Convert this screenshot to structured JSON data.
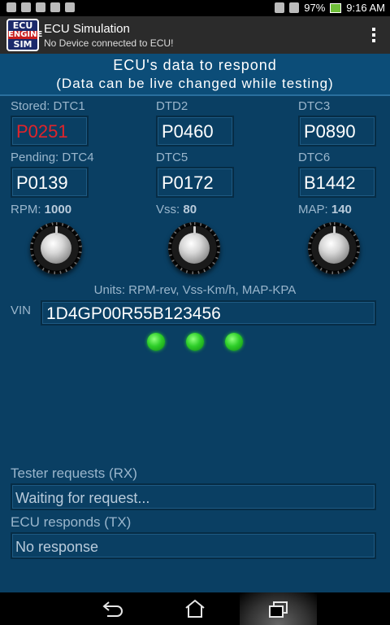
{
  "status_bar": {
    "battery": "97%",
    "time": "9:16 AM"
  },
  "action_bar": {
    "logo": {
      "line1": "ECU",
      "line2": "ENGINE",
      "line3": "SIM"
    },
    "title": "ECU Simulation",
    "subtitle": "No Device connected to ECU!"
  },
  "banner": {
    "line1": "ECU's data to respond",
    "line2": "(Data can be live changed while testing)"
  },
  "dtcs": [
    {
      "label": "Stored: DTC1",
      "code": "P0251",
      "color": "#e0242b"
    },
    {
      "label": "DTD2",
      "code": "P0460"
    },
    {
      "label": "DTC3",
      "code": "P0890"
    },
    {
      "label": "Pending: DTC4",
      "code": "P0139"
    },
    {
      "label": "DTC5",
      "code": "P0172"
    },
    {
      "label": "DTC6",
      "code": "B1442"
    }
  ],
  "knobs": [
    {
      "label": "RPM:",
      "value": "1000"
    },
    {
      "label": "Vss:",
      "value": "80"
    },
    {
      "label": "MAP:",
      "value": "140"
    }
  ],
  "units_text": "Units: RPM-rev, Vss-Km/h, MAP-KPA",
  "vin": {
    "label": "VIN",
    "value": "1D4GP00R55B123456"
  },
  "leds": [
    "green",
    "green",
    "green"
  ],
  "tester": {
    "label": "Tester requests  (RX)",
    "value": "Waiting for request..."
  },
  "ecu": {
    "label": "ECU responds (TX)",
    "value": "No response"
  },
  "nav": [
    "back-icon",
    "home-icon",
    "recent-apps-icon"
  ]
}
